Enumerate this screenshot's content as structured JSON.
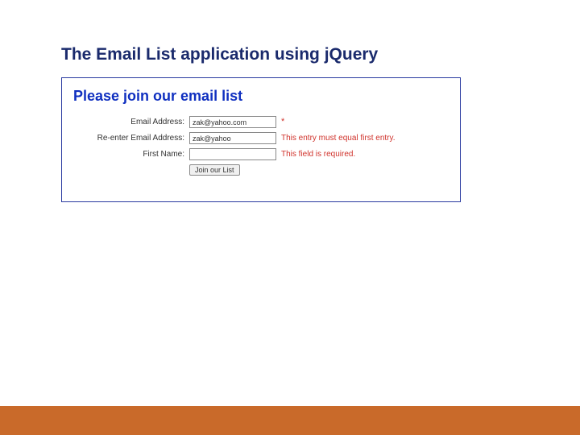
{
  "slide": {
    "title": "The Email List application using jQuery"
  },
  "panel": {
    "heading": "Please join our email list",
    "fields": {
      "email": {
        "label": "Email Address:",
        "value": "zak@yahoo.com",
        "error": ""
      },
      "email2": {
        "label": "Re-enter Email Address:",
        "value": "zak@yahoo",
        "error": "This entry must equal first entry."
      },
      "first_name": {
        "label": "First Name:",
        "value": "",
        "error": "This field is required."
      }
    },
    "submit_label": "Join our List"
  },
  "colors": {
    "accent_border": "#2a3aa0",
    "heading_blue": "#1030c0",
    "error_red": "#d0322b",
    "footer_orange": "#c96a2a"
  }
}
